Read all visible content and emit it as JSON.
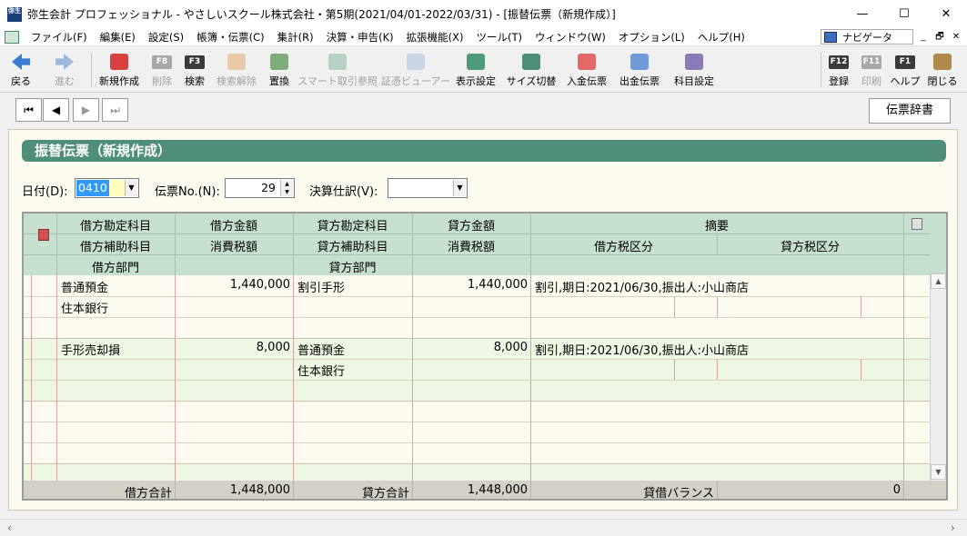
{
  "window": {
    "title": "弥生会計 プロフェッショナル - やさしいスクール株式会社・第5期(2021/04/01-2022/03/31) - [振替伝票（新規作成）]",
    "logo_text": "弥生",
    "minimize": "—",
    "maximize": "☐",
    "close": "✕"
  },
  "menu": {
    "items": [
      "ファイル(F)",
      "編集(E)",
      "設定(S)",
      "帳簿・伝票(C)",
      "集計(R)",
      "決算・申告(K)",
      "拡張機能(X)",
      "ツール(T)",
      "ウィンドウ(W)",
      "オプション(L)",
      "ヘルプ(H)"
    ],
    "navigator": "ナビゲータ",
    "mdi": [
      "_",
      "🗗",
      "✕"
    ]
  },
  "toolbar": {
    "back": "戻る",
    "forward": "進む",
    "new": "新規作成",
    "delete": "削除",
    "delete_key": "F8",
    "search": "検索",
    "search_key": "F3",
    "search_clear": "検索解除",
    "replace": "置換",
    "smart_ref": "スマート取引参照",
    "evidence_viewer": "証憑ビューアー",
    "display_settings": "表示設定",
    "size_toggle": "サイズ切替",
    "deposit_voucher": "入金伝票",
    "withdrawal_voucher": "出金伝票",
    "account_settings": "科目設定",
    "register": "登録",
    "register_key": "F12",
    "print": "印刷",
    "print_key": "F11",
    "help": "ヘルプ",
    "help_key": "F1",
    "close": "閉じる"
  },
  "nav": {
    "first": "⏮",
    "prev": "◀",
    "next": "▶",
    "last": "⏭",
    "dictionary": "伝票辞書"
  },
  "form": {
    "header": "振替伝票（新規作成）",
    "date_label": "日付(D):",
    "date_value": "0410",
    "voucher_no_label": "伝票No.(N):",
    "voucher_no_value": "29",
    "closing_label": "決算仕訳(V):",
    "closing_value": ""
  },
  "grid": {
    "headers": {
      "debit_account": "借方勘定科目",
      "debit_amount": "借方金額",
      "credit_account": "貸方勘定科目",
      "credit_amount": "貸方金額",
      "description": "摘要",
      "debit_sub": "借方補助科目",
      "debit_tax": "消費税額",
      "credit_sub": "貸方補助科目",
      "credit_tax": "消費税額",
      "debit_tax_class": "借方税区分",
      "credit_tax_class": "貸方税区分",
      "debit_dept": "借方部門",
      "credit_dept": "貸方部門"
    },
    "entries": [
      {
        "debit_account": "普通預金",
        "debit_amount": "1,440,000",
        "credit_account": "割引手形",
        "credit_amount": "1,440,000",
        "description": "割引,期日:2021/06/30,振出人:小山商店",
        "debit_sub": "住本銀行",
        "credit_sub": ""
      },
      {
        "debit_account": "手形売却損",
        "debit_amount": "8,000",
        "credit_account": "普通預金",
        "credit_amount": "8,000",
        "description": "割引,期日:2021/06/30,振出人:小山商店",
        "debit_sub": "",
        "credit_sub": "住本銀行"
      }
    ],
    "totals": {
      "debit_label": "借方合計",
      "debit_total": "1,448,000",
      "credit_label": "貸方合計",
      "credit_total": "1,448,000",
      "balance_label": "貸借バランス",
      "balance_value": "0"
    }
  },
  "colors": {
    "header_green": "#4f8f79",
    "grid_header": "#c6dfcf",
    "row_even": "#fdfbef",
    "row_odd": "#eef6e4",
    "date_highlight": "#3399ff"
  }
}
